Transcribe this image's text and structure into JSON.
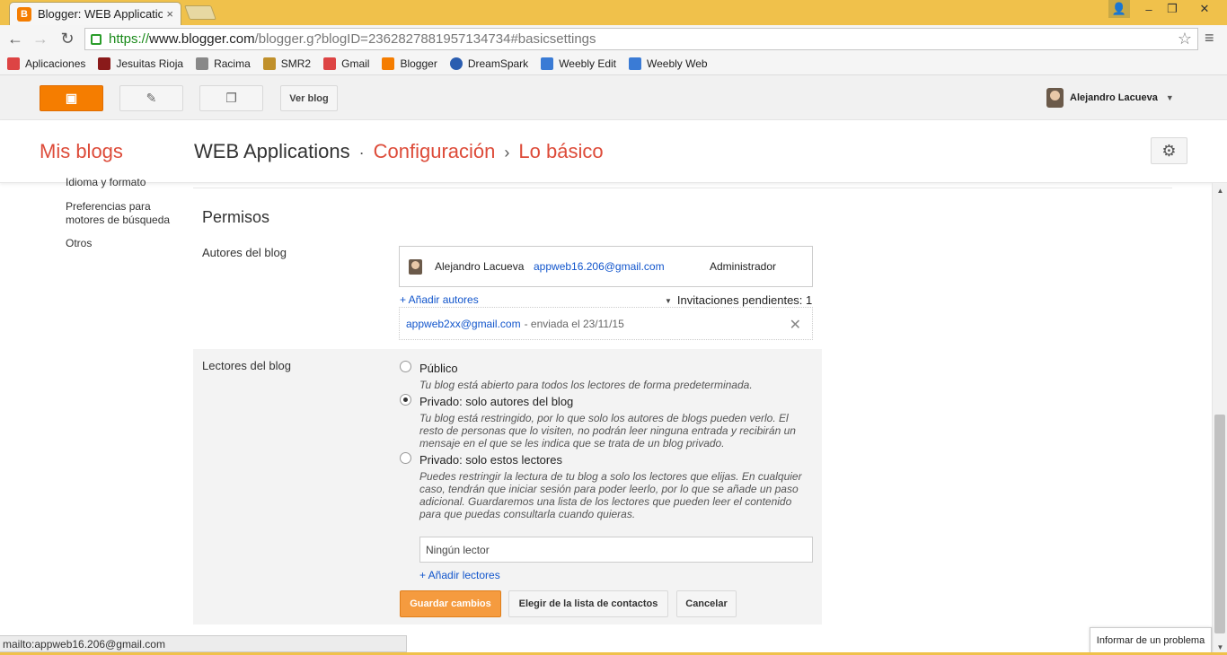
{
  "browser": {
    "tab_title": "Blogger: WEB Application",
    "tab_close": "×",
    "window_controls": {
      "profile": "👤",
      "minimize": "–",
      "maximize": "❐",
      "close": "✕"
    },
    "url_https": "https://",
    "url_host": "www.blogger.com",
    "url_rest": "/blogger.g?blogID=2362827881957134734#basicsettings",
    "bookmarks": [
      {
        "label": "Aplicaciones",
        "icon": "apps-grid-icon",
        "color": "#d44"
      },
      {
        "label": "Jesuitas Rioja",
        "icon": "jesuitas-icon",
        "color": "#8a1a1a"
      },
      {
        "label": "Racima",
        "icon": "racima-icon",
        "color": "#666"
      },
      {
        "label": "SMR2",
        "icon": "smr2-icon",
        "color": "#c0902b"
      },
      {
        "label": "Gmail",
        "icon": "gmail-icon",
        "color": "#d44"
      },
      {
        "label": "Blogger",
        "icon": "blogger-icon",
        "color": "#f57d00"
      },
      {
        "label": "DreamSpark",
        "icon": "dreamspark-icon",
        "color": "#2a5db0"
      },
      {
        "label": "Weebly Edit",
        "icon": "weebly-icon",
        "color": "#3a7bd5"
      },
      {
        "label": "Weebly Web",
        "icon": "weebly-icon",
        "color": "#3a7bd5"
      }
    ]
  },
  "header": {
    "ver_blog": "Ver blog",
    "user_name": "Alejandro Lacueva"
  },
  "title_bar": {
    "mis_blogs": "Mis blogs",
    "blog_name": "WEB Applications",
    "sep1": "·",
    "section": "Configuración",
    "sep2": "›",
    "page": "Lo básico"
  },
  "sidebar": {
    "cut_item": "Idioma y formato",
    "items": [
      "Preferencias para motores de búsqueda",
      "Otros"
    ]
  },
  "permisos": {
    "title": "Permisos",
    "autores_label": "Autores del blog",
    "author": {
      "name": "Alejandro Lacueva",
      "email": "appweb16.206@gmail.com",
      "role": "Administrador"
    },
    "add_authors": "+ Añadir autores",
    "invitations": "Invitaciones pendientes: 1",
    "invite": {
      "email": "appweb2xx@gmail.com",
      "status": "- enviada el 23/11/15"
    }
  },
  "readers": {
    "label": "Lectores del blog",
    "options": [
      {
        "title": "Público",
        "desc": "Tu blog está abierto para todos los lectores de forma predeterminada.",
        "checked": false
      },
      {
        "title": "Privado: solo autores del blog",
        "desc": "Tu blog está restringido, por lo que solo los autores de blogs pueden verlo. El resto de personas que lo visiten, no podrán leer ninguna entrada y recibirán un mensaje en el que se les indica que se trata de un blog privado.",
        "checked": true
      },
      {
        "title": "Privado: solo estos lectores",
        "desc": "Puedes restringir la lectura de tu blog a solo los lectores que elijas. En cualquier caso, tendrán que iniciar sesión para poder leerlo, por lo que se añade un paso adicional. Guardaremos una lista de los lectores que pueden leer el contenido para que puedas consultarla cuando quieras.",
        "checked": false
      }
    ],
    "no_reader": "Ningún lector",
    "add_readers": "+ Añadir lectores"
  },
  "buttons": {
    "save": "Guardar cambios",
    "contacts": "Elegir de la lista de contactos",
    "cancel": "Cancelar"
  },
  "status_bar": "mailto:appweb16.206@gmail.com",
  "report_problem": "Informar de un problema"
}
